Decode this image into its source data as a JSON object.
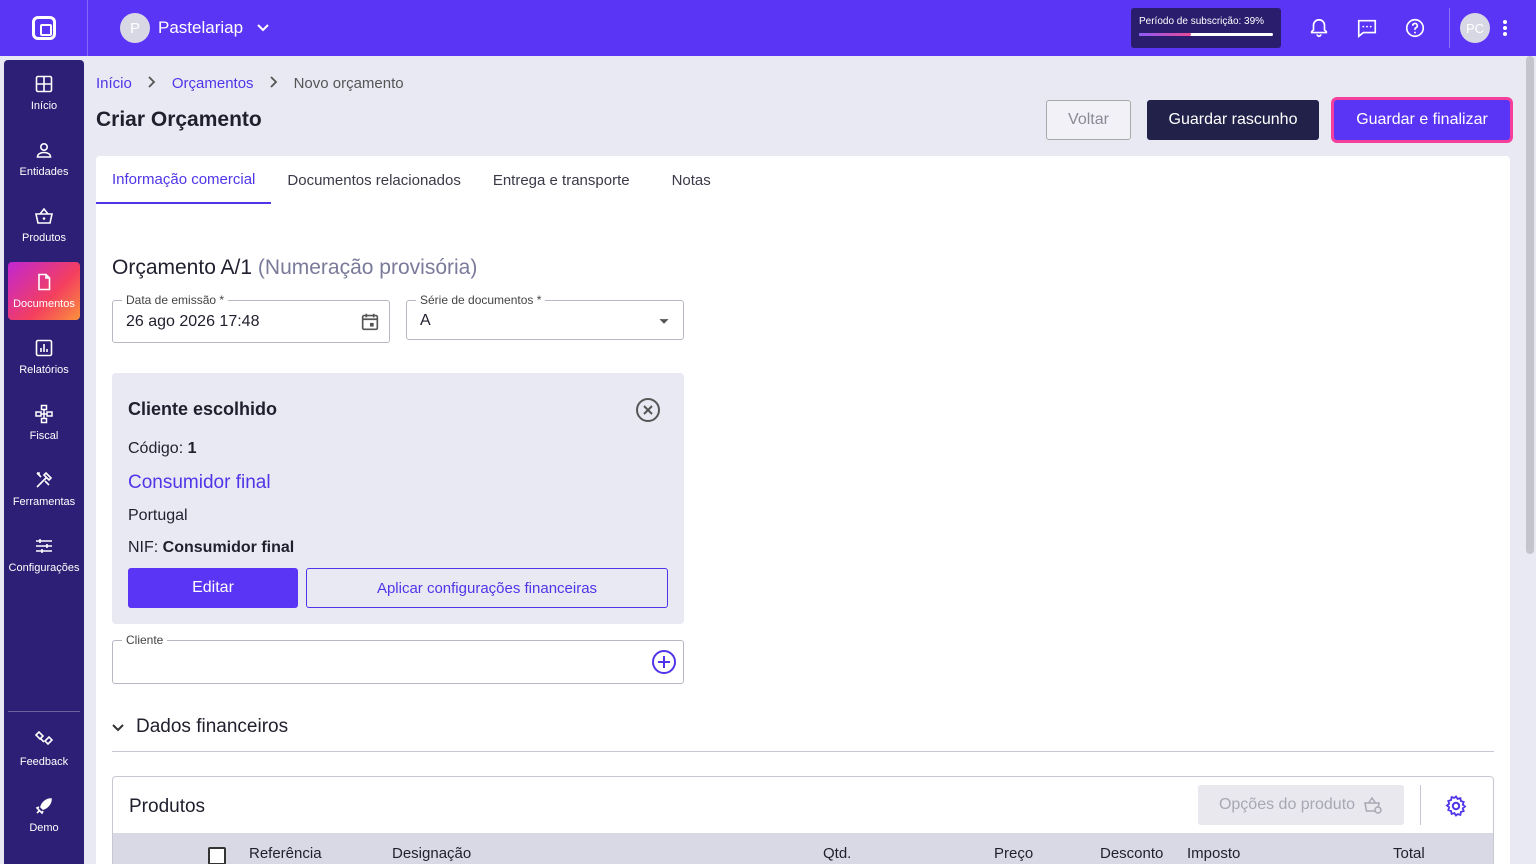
{
  "topbar": {
    "company_initial": "P",
    "company_name": "Pastelariap",
    "subscription_label": "Período de subscrição: 39%",
    "subscription_progress": 39,
    "user_initials": "PC"
  },
  "sidebar": {
    "items": [
      {
        "label": "Início",
        "icon": "grid-icon"
      },
      {
        "label": "Entidades",
        "icon": "person-icon"
      },
      {
        "label": "Produtos",
        "icon": "basket-icon"
      },
      {
        "label": "Documentos",
        "icon": "document-icon",
        "active": true
      },
      {
        "label": "Relatórios",
        "icon": "chart-icon"
      },
      {
        "label": "Fiscal",
        "icon": "tree-icon"
      },
      {
        "label": "Ferramentas",
        "icon": "tools-icon"
      },
      {
        "label": "Configurações",
        "icon": "sliders-icon"
      }
    ],
    "bottom_items": [
      {
        "label": "Feedback",
        "icon": "feedback-icon"
      },
      {
        "label": "Demo",
        "icon": "rocket-icon"
      }
    ]
  },
  "breadcrumb": {
    "home": "Início",
    "section": "Orçamentos",
    "current": "Novo orçamento"
  },
  "page": {
    "title": "Criar Orçamento",
    "back_label": "Voltar",
    "draft_label": "Guardar rascunho",
    "finalize_label": "Guardar e finalizar"
  },
  "tabs": [
    {
      "label": "Informação comercial",
      "active": true
    },
    {
      "label": "Documentos relacionados"
    },
    {
      "label": "Entrega e transporte"
    },
    {
      "label": "Notas"
    }
  ],
  "document": {
    "title": "Orçamento A/1",
    "subtitle": "(Numeração provisória)",
    "issue_date_label": "Data de emissão *",
    "issue_date_value": "26 ago 2026 17:48",
    "series_label": "Série de documentos *",
    "series_value": "A"
  },
  "client": {
    "title": "Cliente escolhido",
    "code_label": "Código: ",
    "code_value": "1",
    "name": "Consumidor final",
    "country": "Portugal",
    "nif_label": "NIF: ",
    "nif_value": "Consumidor final",
    "edit_label": "Editar",
    "apply_label": "Aplicar configurações financeiras",
    "field_label": "Cliente"
  },
  "financial": {
    "section_label": "Dados financeiros"
  },
  "products": {
    "title": "Produtos",
    "options_label": "Opções do produto",
    "columns": [
      "Referência",
      "Designação",
      "Qtd.",
      "Preço",
      "Desconto",
      "Imposto",
      "Total"
    ]
  },
  "colors": {
    "brand": "#5b35f5",
    "sidebar": "#2c1f75",
    "accent_pink": "#f43f9c"
  }
}
